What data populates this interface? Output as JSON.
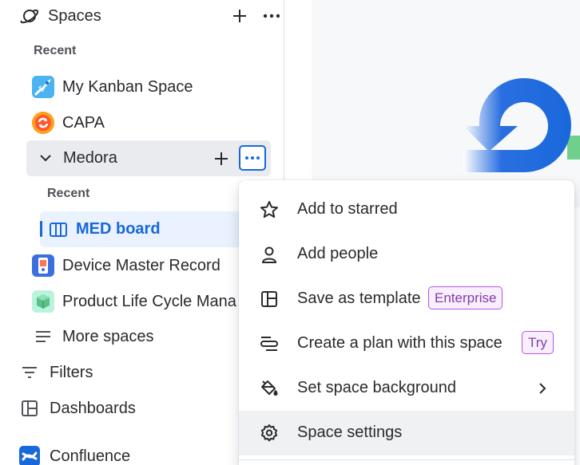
{
  "sidebar": {
    "spaces_header": {
      "label": "Spaces",
      "icon": "planet-icon",
      "add_icon": "plus-icon",
      "more_icon": "more-horizontal-icon"
    },
    "recent_title": "Recent",
    "recent_spaces": [
      {
        "label": "My Kanban Space",
        "icon": "rocket-avatar-icon"
      },
      {
        "label": "CAPA",
        "icon": "capa-avatar-icon"
      }
    ],
    "expanded_space": {
      "label": "Medora",
      "icon": "chevron-down-icon",
      "recent_title": "Recent",
      "boards": [
        {
          "label": "MED board",
          "icon": "board-columns-icon"
        }
      ]
    },
    "more_spaces_list": [
      {
        "label": "Device Master Record",
        "icon": "device-avatar-icon"
      },
      {
        "label": "Product Life Cycle Mana",
        "icon": "cube-avatar-icon"
      }
    ],
    "more_spaces": {
      "label": "More spaces",
      "icon": "list-icon"
    },
    "filters": {
      "label": "Filters",
      "icon": "filter-icon"
    },
    "dashboards": {
      "label": "Dashboards",
      "icon": "dashboard-icon"
    },
    "confluence": {
      "label": "Confluence",
      "icon": "confluence-logo-icon"
    }
  },
  "menu": {
    "items": [
      {
        "label": "Add to starred",
        "icon": "star-icon"
      },
      {
        "label": "Add people",
        "icon": "person-icon"
      },
      {
        "label": "Save as template",
        "icon": "template-icon",
        "badge": "Enterprise"
      },
      {
        "label": "Create a plan with this space",
        "icon": "plan-icon",
        "badge": "Try"
      },
      {
        "label": "Set space background",
        "icon": "paint-bucket-icon",
        "submenu_icon": "chevron-right-icon"
      },
      {
        "label": "Space settings",
        "icon": "gear-icon",
        "state": "hovered"
      }
    ]
  },
  "colors": {
    "accent": "#1868db",
    "selected_bg": "#e9f2fe",
    "hover_bg": "#e9ebee",
    "badge_bg": "#f8eefe",
    "badge_border": "#af59e1",
    "badge_text": "#803fa5",
    "text": "#292a2e",
    "subtle_text": "#505258"
  }
}
